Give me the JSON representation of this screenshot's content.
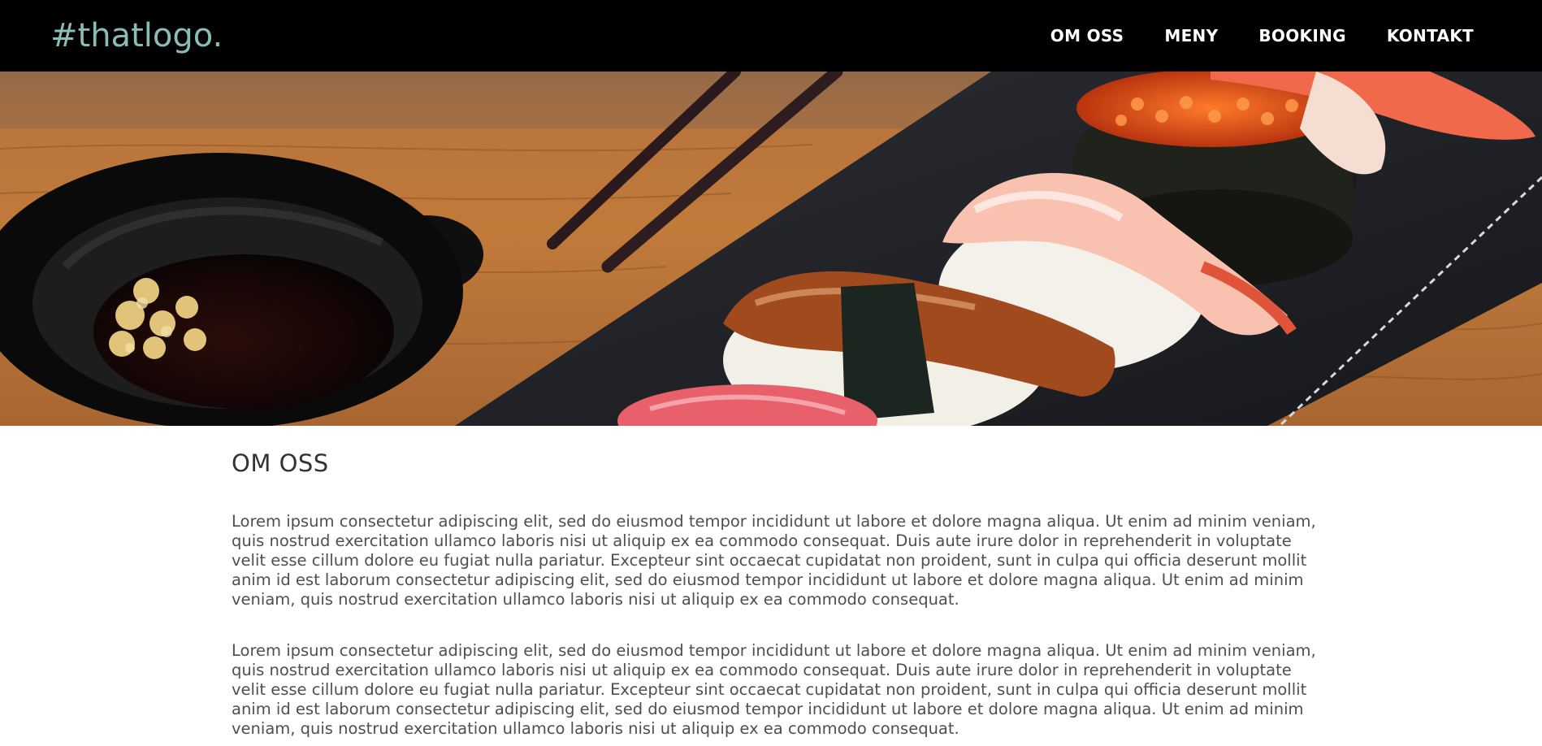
{
  "header": {
    "logo": "#thatlogo.",
    "nav": [
      {
        "label": "OM OSS"
      },
      {
        "label": "MENY"
      },
      {
        "label": "BOOKING"
      },
      {
        "label": "KONTAKT"
      }
    ]
  },
  "hero": {
    "image": "sushi-platter-photo"
  },
  "main": {
    "title": "OM OSS",
    "paragraphs": [
      "Lorem ipsum consectetur adipiscing elit, sed do eiusmod tempor incididunt ut labore et dolore magna aliqua. Ut enim ad minim veniam, quis nostrud exercitation ullamco laboris nisi ut aliquip ex ea commodo consequat. Duis aute irure dolor in reprehenderit in voluptate velit esse cillum dolore eu fugiat nulla pariatur. Excepteur sint occaecat cupidatat non proident, sunt in culpa qui officia deserunt mollit anim id est laborum consectetur adipiscing elit, sed do eiusmod tempor incididunt ut labore et dolore magna aliqua. Ut enim ad minim veniam, quis nostrud exercitation ullamco laboris nisi ut aliquip ex ea commodo consequat.",
      "Lorem ipsum consectetur adipiscing elit, sed do eiusmod tempor incididunt ut labore et dolore magna aliqua. Ut enim ad minim veniam, quis nostrud exercitation ullamco laboris nisi ut aliquip ex ea commodo consequat. Duis aute irure dolor in reprehenderit in voluptate velit esse cillum dolore eu fugiat nulla pariatur. Excepteur sint occaecat cupidatat non proident, sunt in culpa qui officia deserunt mollit anim id est laborum consectetur adipiscing elit, sed do eiusmod tempor incididunt ut labore et dolore magna aliqua. Ut enim ad minim veniam, quis nostrud exercitation ullamco laboris nisi ut aliquip ex ea commodo consequat."
    ]
  },
  "colors": {
    "header_bg": "#000000",
    "logo": "#8bbdb8",
    "nav_text": "#ffffff",
    "title_text": "#333333",
    "body_text": "#4f4f4f"
  }
}
